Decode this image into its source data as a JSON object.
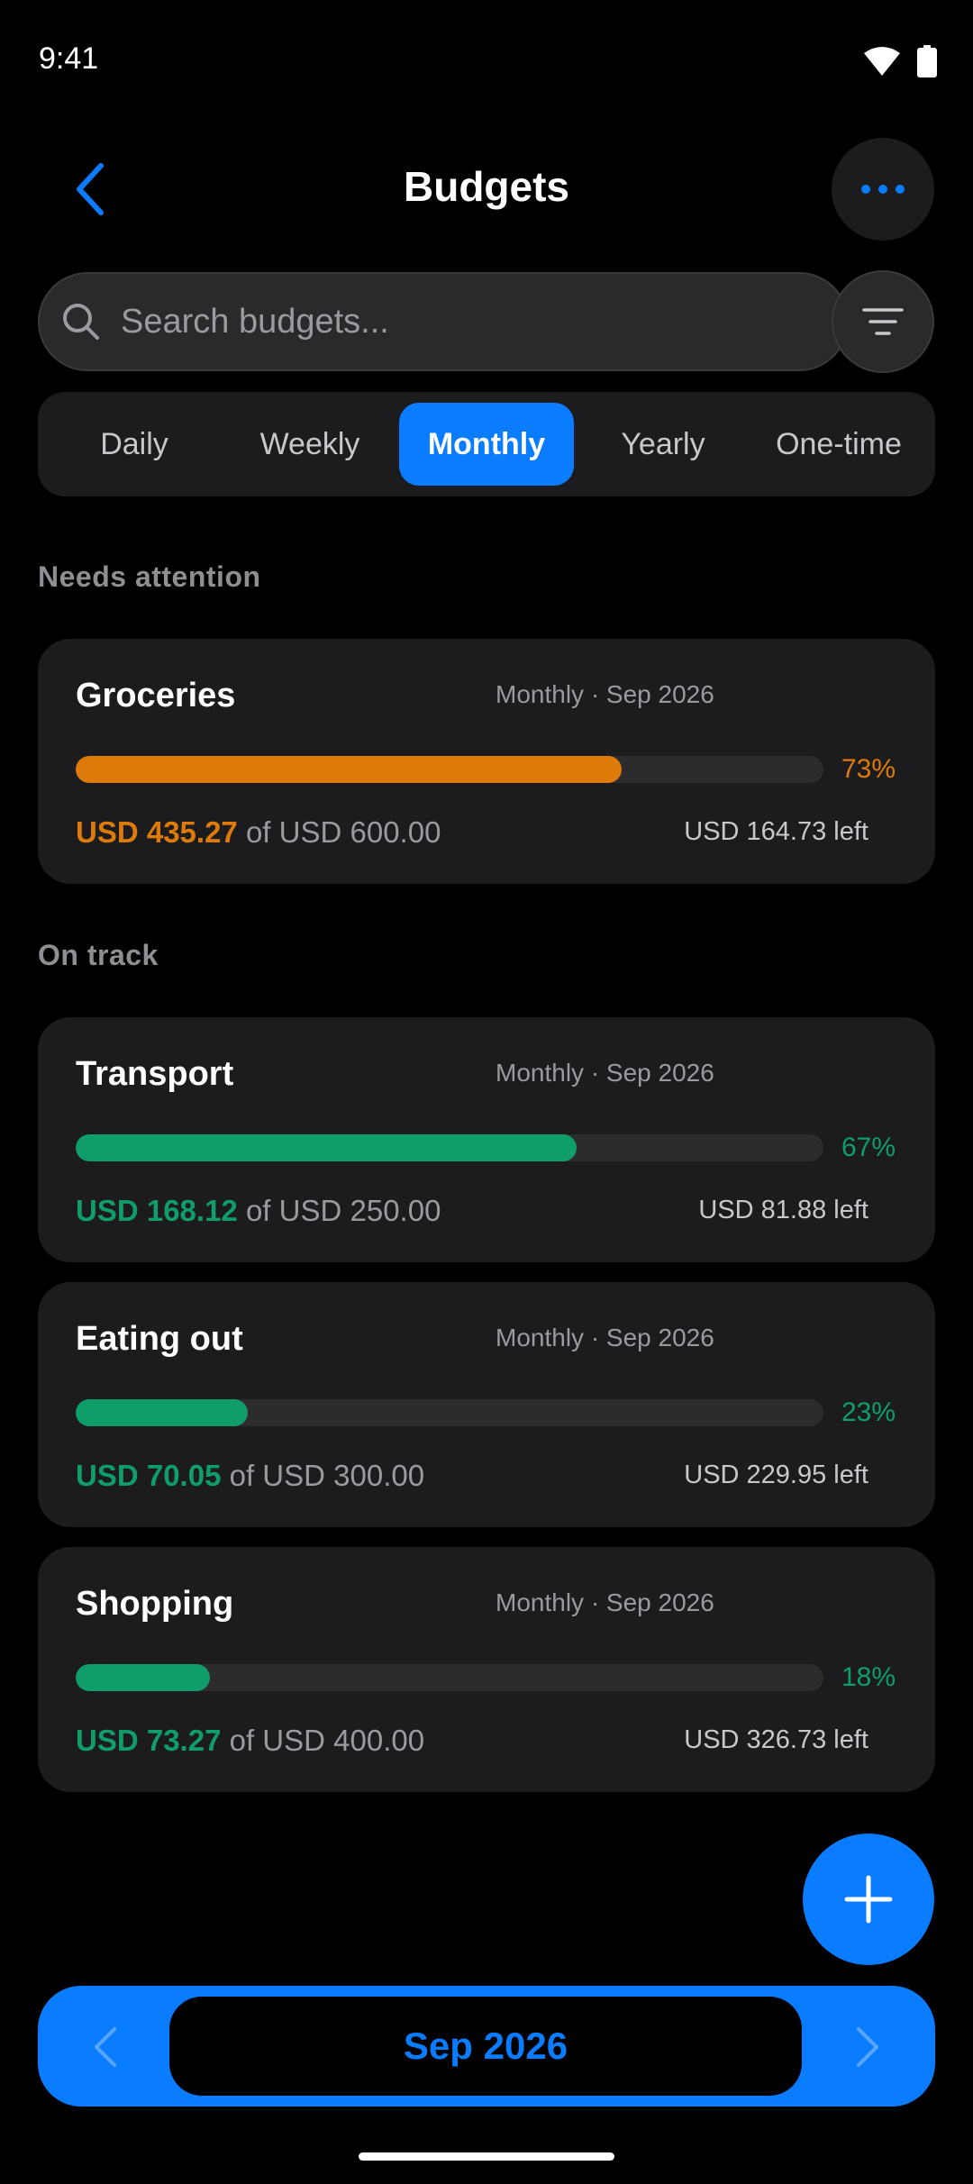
{
  "status": {
    "time": "9:41"
  },
  "header": {
    "title": "Budgets"
  },
  "search": {
    "placeholder": "Search budgets..."
  },
  "tabs": [
    {
      "label": "Daily",
      "active": false
    },
    {
      "label": "Weekly",
      "active": false
    },
    {
      "label": "Monthly",
      "active": true
    },
    {
      "label": "Yearly",
      "active": false
    },
    {
      "label": "One-time",
      "active": false
    }
  ],
  "sections": {
    "attention": "Needs attention",
    "on_track": "On track"
  },
  "colors": {
    "accent": "#0a7cff",
    "warning": "#dd7a0a",
    "ok": "#0f9d6a"
  },
  "budgets": [
    {
      "name": "Groceries",
      "period": "Monthly · Sep 2026",
      "percent": 73,
      "percent_label": "73%",
      "spent": "USD 435.27",
      "total": "of USD 600.00",
      "left": "USD 164.73 left",
      "status": "warning"
    },
    {
      "name": "Transport",
      "period": "Monthly · Sep 2026",
      "percent": 67,
      "percent_label": "67%",
      "spent": "USD 168.12",
      "total": "of USD 250.00",
      "left": "USD 81.88 left",
      "status": "ok"
    },
    {
      "name": "Eating out",
      "period": "Monthly · Sep 2026",
      "percent": 23,
      "percent_label": "23%",
      "spent": "USD 70.05",
      "total": "of USD 300.00",
      "left": "USD 229.95 left",
      "status": "ok"
    },
    {
      "name": "Shopping",
      "period": "Monthly · Sep 2026",
      "percent": 18,
      "percent_label": "18%",
      "spent": "USD 73.27",
      "total": "of USD 400.00",
      "left": "USD 326.73 left",
      "status": "ok"
    }
  ],
  "month_nav": {
    "label": "Sep 2026"
  },
  "icons": [
    "wifi-icon",
    "battery-icon",
    "back-chevron-icon",
    "more-dots-icon",
    "search-icon",
    "filter-icon",
    "plus-icon",
    "chevron-left-icon",
    "chevron-right-icon"
  ]
}
